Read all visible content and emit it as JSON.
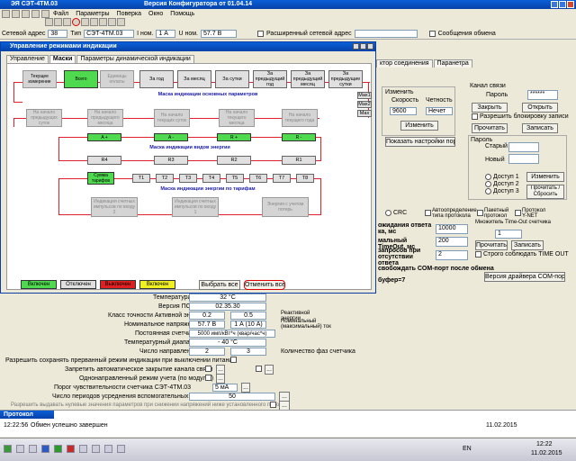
{
  "app": {
    "title_left": "ЭЯ СЭТ-4ТМ.03",
    "title_center": "Версия Конфигуратора от 01.04.14",
    "menu": [
      "Файл",
      "Параметры",
      "Поверка",
      "Окно",
      "Помощь"
    ]
  },
  "toolbar2": {
    "net_addr_label": "Сетевой адрес",
    "net_addr_value": "38",
    "type_label": "Тип",
    "type_value": "СЭТ-4ТМ.03",
    "inom_label": "I ном.",
    "inom_value": "1 А",
    "unom_label": "U ном.",
    "unom_value": "57.7 В",
    "ext_addr_label": "Расширенный сетевой адрес",
    "exchange_msg_label": "Сообщения обмена"
  },
  "dialog": {
    "title": "Управление режимами индикации",
    "tabs": [
      "Управление",
      "Маски",
      "Параметры динамической индикации"
    ],
    "active_tab": 1,
    "row1": [
      "Текущее измерение",
      "Всего",
      "Единицы оплаты",
      "За год",
      "За месяц",
      "За сутки",
      "За предыдущий год",
      "За предыдущий месяц",
      "За предыдущие сутки"
    ],
    "main_mask_title": "Маска индикации основных параметров",
    "max_buttons": [
      "Мах1",
      "Мах2",
      "Мах"
    ],
    "row2": [
      "На начало предыдущих суток",
      "На начало предыдущего месяца",
      "На начало текущих суток",
      "На начало текущего месяца",
      "На начало текущего года"
    ],
    "types_row": [
      "A +",
      "A -",
      "R +",
      "R -"
    ],
    "types_title": "Маска индикации видов энергии",
    "types_row2": [
      "R4",
      "R3",
      "R2",
      "R1"
    ],
    "sum_tariff": "Сумма тарифов",
    "tariffs": [
      "T1",
      "T2",
      "T3",
      "T4",
      "T5",
      "T6",
      "T7",
      "T8"
    ],
    "tariff_title": "Маска индикации энергии по тарифам",
    "pulse_buttons": [
      "Индикация счетных импульсов по входу 2",
      "Индикация счетных импульсов по входу 1",
      "Энергия с учетом потерь"
    ],
    "legend": [
      "Включен",
      "Отключен",
      "Выключен",
      "Включен"
    ],
    "select_all": "Выбрать все",
    "cancel_all": "Отменить все"
  },
  "right_panel": {
    "tabs": [
      "ктор соединения",
      "Паранетра"
    ],
    "change_label": "Изменить",
    "speed_label": "Скорость",
    "parity_label": "Четность",
    "speed_value": "9600",
    "parity_value": "Нечет",
    "change_btn": "Изменить",
    "show_settings_btn": "Показать настройки порта",
    "channel_label": "Канал связи",
    "password_label": "Пароль",
    "password_value": "******",
    "close_btn": "Закрыть",
    "open_btn": "Открыть",
    "allow_lock_label": "Разрешить блокировку записи",
    "read_btn": "Прочитать",
    "write_btn": "Записать",
    "pwd_group": "Пароль",
    "old_label": "Старый",
    "new_label": "Новый",
    "access1": "Доступ 1",
    "access2": "Доступ 2",
    "access3": "Доступ 3",
    "change2_btn": "Изменить",
    "read_reset_btn": "Прочитать / Сбросить",
    "crc_label": "CRC",
    "auto_detect_label": "Автоопределение типа протокола",
    "packet_label": "Пакетный протокол",
    "ynet_label": "Протокол Y-NET",
    "wait_label": "ожидания ответа ка, мс",
    "wait_value": "10000",
    "multiplier_label": "Множитель Time-Out счетчика",
    "multiplier_value": "1",
    "timeout_label": "мальный TimeOut, мс",
    "timeout_value": "200",
    "read2_btn": "Прочитать",
    "write2_btn": "Записать",
    "requests_label": "запросов при отсутствии ответа",
    "requests_value": "2",
    "strict_timeout_label": "Строго соблюдать TIME OUT",
    "free_com_label": "свобождать COM-порт после обмена",
    "buffer_label": "буфер=7",
    "driver_btn": "Версия драйвера COM-порта"
  },
  "lower_form": {
    "temperature_label": "Температура",
    "temperature_value": "32 °C",
    "po_label": "Версия ПО",
    "po_value": "02.35.30",
    "accuracy_label": "Класс точности Активной энергии",
    "accuracy_value1": "0.2",
    "accuracy_value2": "0.5",
    "reactive_label": "Реактивной энергии",
    "nominal_u_label": "Номинальное напряжение",
    "nominal_u_value": "57.7 В",
    "nominal_i_value": "1 А (10 А)",
    "nominal_max_label": "Номинальный (максимальный) ток",
    "constant_label": "Постоянная счетчика",
    "constant_value": "5000 имп/кВт*ч (квар/час*ч)",
    "temp_range_label": "Температурный диапазон",
    "temp_range_value": "- 40 °C",
    "directions_label": "Число направлений",
    "directions_value": "2",
    "phases_value": "3",
    "phases_label": "Количество фаз счетчика",
    "allow_save_label": "Разрешить сохранять прерванный режим индикации при выключении питания",
    "forbid_close_label": "Запретить автоматическое закрытие канала связи",
    "unidirectional_label": "Однонаправленный режим учета (по модулю)",
    "sensitivity_label": "Порог чувствительности счетчика СЭТ-4ТМ.03",
    "sensitivity_value": "5 мА",
    "averaging_label": "Число периодов усреднения вспомогательных параметров",
    "averaging_value": "50",
    "allow_show_label": "Разрешить выдавать нулевые значения параметров при снижении напряжений ниже установленного порога"
  },
  "protocol_window": {
    "title": "Протокол",
    "time": "12:22:56",
    "message": "Обмен успешно завершен",
    "date": "11.02.2015"
  },
  "taskbar": {
    "lang": "EN",
    "time": "12:22",
    "date": "11.02.2015"
  }
}
